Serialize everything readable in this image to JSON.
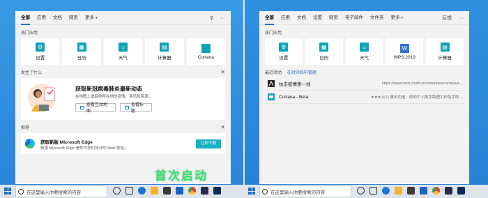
{
  "left": {
    "tabs": [
      "全部",
      "应用",
      "文档",
      "网页",
      "更多"
    ],
    "top_apps_title": "热门应用",
    "apps": [
      {
        "label": "设置",
        "icon": "gear-icon",
        "glyph": "⚙"
      },
      {
        "label": "日历",
        "icon": "calendar-icon",
        "glyph": "▦"
      },
      {
        "label": "天气",
        "icon": "weather-icon",
        "glyph": "☼"
      },
      {
        "label": "计算器",
        "icon": "calculator-icon",
        "glyph": "▤"
      },
      {
        "label": "Cortana",
        "icon": "cortana-icon",
        "glyph": ""
      }
    ],
    "news_section": "发生了什么",
    "news": {
      "title": "获取新冠病毒肺炎最新动态",
      "subtitle": "在地图上追踪你所在地的疫情、资讯和资源。",
      "btn_map": "查看互动地图",
      "btn_headlines": "查看标题"
    },
    "recommend_title": "推荐",
    "edge": {
      "title": "获取新版 Microsoft Edge",
      "subtitle": "新版 Microsoft Edge 是你为你们设计的 Web 体验。",
      "button": "立即下载"
    },
    "caption": "首次启动",
    "search_placeholder": "在这里输入你要搜索的内容"
  },
  "right": {
    "tabs": [
      "全部",
      "应用",
      "文档",
      "设置",
      "网页",
      "电子邮件",
      "文件夹",
      "更多"
    ],
    "top_right": "反馈",
    "top_apps_title": "热门应用",
    "apps": [
      {
        "label": "设置",
        "icon": "gear-icon",
        "glyph": "⚙"
      },
      {
        "label": "日历",
        "icon": "calendar-icon",
        "glyph": "▦"
      },
      {
        "label": "天气",
        "icon": "weather-icon",
        "glyph": "☼"
      },
      {
        "label": "WPS 2019",
        "icon": "wps-icon",
        "glyph": "W"
      },
      {
        "label": "计算器",
        "icon": "calculator-icon",
        "glyph": "▤"
      }
    ],
    "recent_title": "最近活动",
    "recent_link": "在时间线中管理",
    "recent": [
      {
        "title": "抗击疫情第一线",
        "meta": "https://www.msn.cn/zh-cn/news/newcoronavir..."
      },
      {
        "title": "Cortana - Beta",
        "meta": "★★★ (67) 事半功倍，你的个人数字助理工作助手呼..."
      }
    ],
    "search_placeholder": "在这里输入你要搜索的内容"
  },
  "colors": {
    "accent": "#0fa3b8",
    "caption": "#2ee36c",
    "desktop": "#2d8fe0"
  }
}
